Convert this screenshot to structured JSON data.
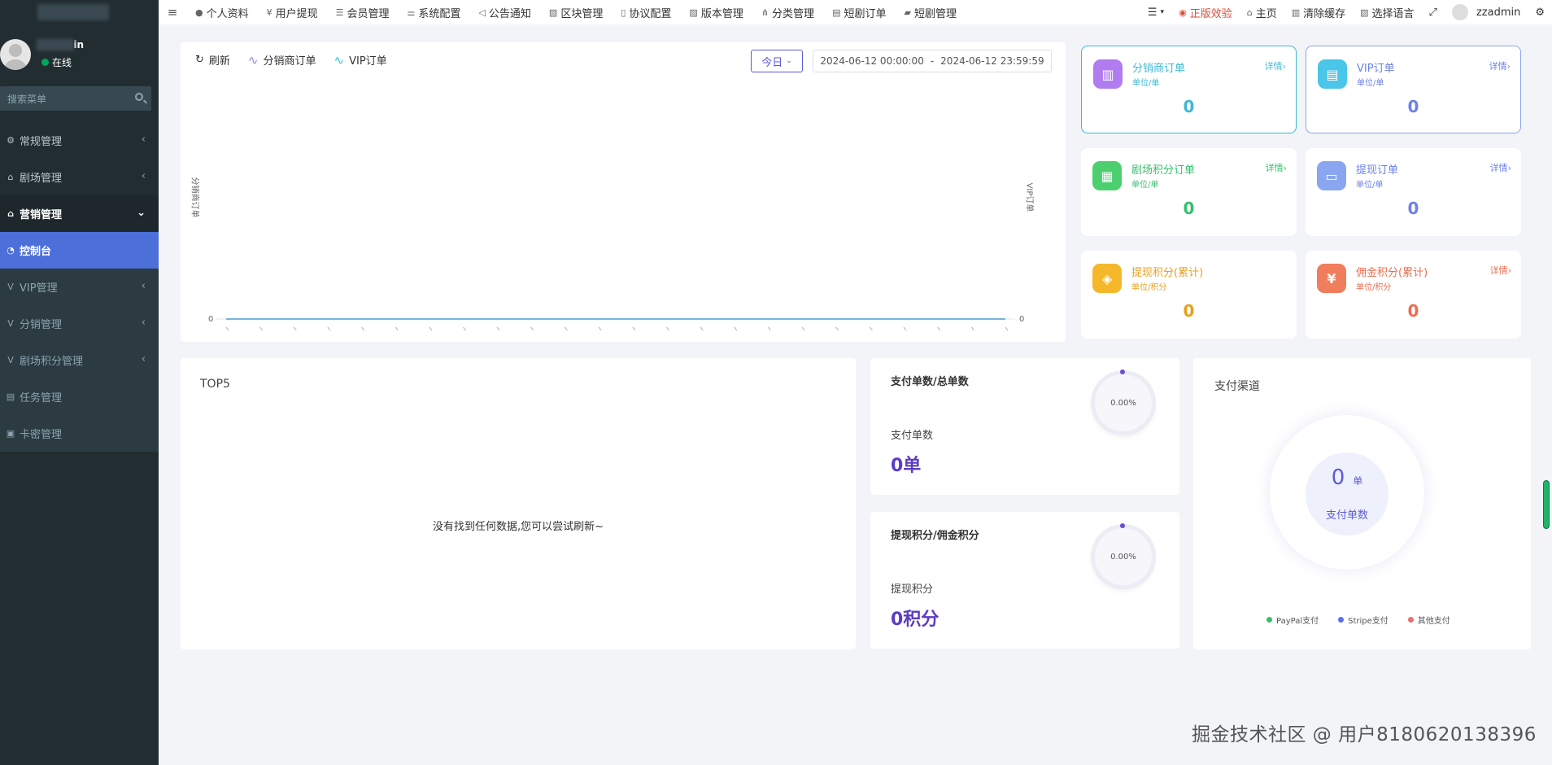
{
  "sidebar": {
    "user": {
      "name_suffix": "in",
      "status": "在线"
    },
    "search_placeholder": "搜索菜单",
    "items": [
      {
        "label": "常规管理",
        "icon": "gears-icon"
      },
      {
        "label": "剧场管理",
        "icon": "home-icon"
      },
      {
        "label": "营销管理",
        "icon": "home-icon"
      }
    ],
    "sub_items": [
      {
        "label": "控制台",
        "icon": "dashboard-icon"
      },
      {
        "label": "VIP管理",
        "icon": "v-icon"
      },
      {
        "label": "分销管理",
        "icon": "v-icon"
      },
      {
        "label": "剧场积分管理",
        "icon": "v-icon"
      },
      {
        "label": "任务管理",
        "icon": "file-icon"
      },
      {
        "label": "卡密管理",
        "icon": "card-icon"
      }
    ]
  },
  "topbar": {
    "nav": [
      "个人资料",
      "用户提现",
      "会员管理",
      "系统配置",
      "公告通知",
      "区块管理",
      "协议配置",
      "版本管理",
      "分类管理",
      "短剧订单",
      "短剧管理"
    ],
    "right": {
      "license": "正版效验",
      "home": "主页",
      "clear_cache": "清除缓存",
      "language": "选择语言",
      "username": "zzadmin"
    }
  },
  "chart_panel": {
    "refresh": "刷新",
    "legend": [
      "分销商订单",
      "VIP订单"
    ],
    "period": "今日",
    "date_start": "2024-06-12 00:00:00",
    "date_sep": "-",
    "date_end": "2024-06-12 23:59:59",
    "ylabel_left": "分销商订单",
    "ylabel_right": "VIP订单",
    "y_zero_left": "0",
    "y_zero_right": "0"
  },
  "chart_data": {
    "type": "line",
    "series": [
      {
        "name": "分销商订单",
        "values": [
          0,
          0,
          0,
          0,
          0,
          0,
          0,
          0,
          0,
          0,
          0,
          0,
          0,
          0,
          0,
          0,
          0,
          0,
          0,
          0,
          0,
          0,
          0,
          0
        ],
        "color": "#5b5bd6"
      },
      {
        "name": "VIP订单",
        "values": [
          0,
          0,
          0,
          0,
          0,
          0,
          0,
          0,
          0,
          0,
          0,
          0,
          0,
          0,
          0,
          0,
          0,
          0,
          0,
          0,
          0,
          0,
          0,
          0
        ],
        "color": "#3fc1d8"
      }
    ],
    "ylim": [
      0,
      1
    ]
  },
  "stats": [
    {
      "title": "分销商订单",
      "unit": "单位/单",
      "detail": "详情›",
      "value": "0",
      "color": "#3fb8d4",
      "icon_bg": "#b07cf0",
      "icon": "chart-icon"
    },
    {
      "title": "VIP订单",
      "unit": "单位/单",
      "detail": "详情›",
      "value": "0",
      "color": "#6b82e8",
      "icon_bg": "#49c6e8",
      "icon": "document-icon"
    },
    {
      "title": "剧场积分订单",
      "unit": "单位/单",
      "detail": "详情›",
      "value": "0",
      "color": "#34c16b",
      "icon_bg": "#4cd06f",
      "icon": "calendar-icon"
    },
    {
      "title": "提现订单",
      "unit": "单位/单",
      "detail": "详情›",
      "value": "0",
      "color": "#6b82e8",
      "icon_bg": "#8aa6f0",
      "icon": "wallet-icon"
    },
    {
      "title": "提现积分(累计)",
      "unit": "单位/积分",
      "detail": "",
      "value": "0",
      "color": "#e8a01e",
      "icon_bg": "#f5b82a",
      "icon": "shield-icon"
    },
    {
      "title": "佣金积分(累计)",
      "unit": "单位/积分",
      "detail": "详情›",
      "value": "0",
      "color": "#ec6d4f",
      "icon_bg": "#f07e5c",
      "icon": "yen-icon"
    }
  ],
  "top5": {
    "title": "TOP5",
    "empty": "没有找到任何数据,您可以尝试刷新~"
  },
  "pay_ratio": {
    "title": "支付单数/总单数",
    "percent": "0.00%",
    "label": "支付单数",
    "value": "0单"
  },
  "withdraw_ratio": {
    "title": "提现积分/佣金积分",
    "percent": "0.00%",
    "label": "提现积分",
    "value": "0积分"
  },
  "channel": {
    "title": "支付渠道",
    "count": "0",
    "count_unit": "单",
    "caption": "支付单数",
    "legend": [
      {
        "label": "PayPal支付",
        "color": "#34c16b"
      },
      {
        "label": "Stripe支付",
        "color": "#5b6fe8"
      },
      {
        "label": "其他支付",
        "color": "#ec6d6d"
      }
    ]
  },
  "watermark": "掘金技术社区 @ 用户8180620138396"
}
